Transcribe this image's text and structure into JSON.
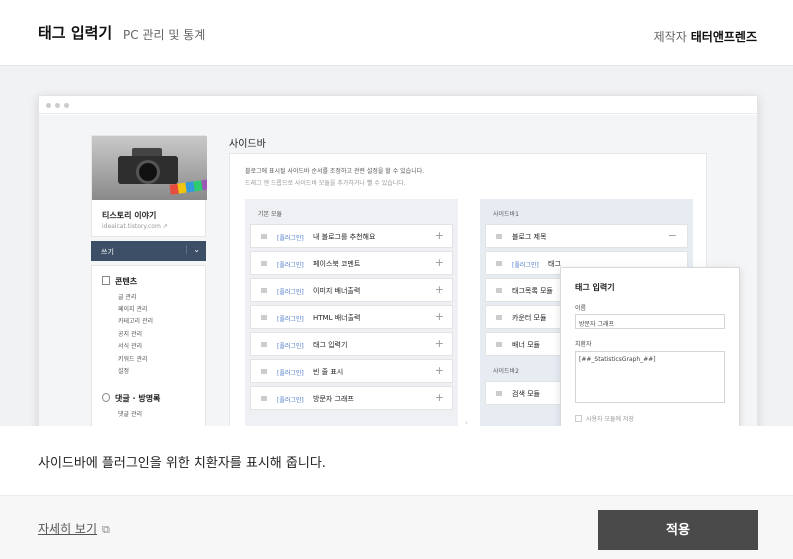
{
  "header": {
    "title": "태그 입력기",
    "subtitle": "PC 관리 및 통계",
    "maker_label": "제작자",
    "maker_name": "태터앤프렌즈"
  },
  "preview": {
    "blog": {
      "name": "티스토리 이야기",
      "url": "idealcat.tistory.com",
      "write_label": "쓰기",
      "menu": {
        "content_section": "콘텐츠",
        "content_items": [
          "글 관리",
          "페이지 관리",
          "카테고리 관리",
          "공지 관리",
          "서식 관리",
          "키워드 관리",
          "설정"
        ],
        "comment_section": "댓글 · 방명록",
        "comment_items": [
          "댓글 관리"
        ]
      }
    },
    "sidebar": {
      "title": "사이드바",
      "description": "블로그에 표시될 사이드바 순서를 조정하고 관련 설정을 할 수 있습니다.",
      "hint": "드래그 앤 드롭으로 사이드바 모듈을 추가하거나 뺄 수 있습니다.",
      "basic_header": "기본 모듈",
      "plugin_tag": "[플러그인]",
      "basic_modules": [
        "내 블로그를 추천해요",
        "페이스북 코멘트",
        "이미지 배너출력",
        "HTML 배너출력",
        "태그 입력기",
        "빈 줄 표시",
        "방문자 그래프"
      ],
      "sidebar1_header": "사이드바1",
      "sidebar1_modules": [
        "블로그 제목",
        "태그",
        "태그목록 모듈",
        "카운터 모듈",
        "배너 모듈"
      ],
      "sidebar2_header": "사이드바2",
      "sidebar2_modules": [
        "검색 모듈"
      ]
    },
    "popup": {
      "title": "태그 입력기",
      "name_label": "이름",
      "name_value": "방문자 그래프",
      "substitute_label": "치환자",
      "substitute_value": "[##_StatisticsGraph_##]",
      "checkbox_label": "사용자 모듈에 저장"
    }
  },
  "description": "사이드바에 플러그인을 위한 치환자를 표시해 줍니다.",
  "footer": {
    "more_label": "자세히 보기",
    "apply_label": "적용"
  },
  "colors": {
    "apply_button": "#4a4a4a",
    "plugin_tag": "#4c7bc7",
    "write_button": "#3c4f66"
  }
}
